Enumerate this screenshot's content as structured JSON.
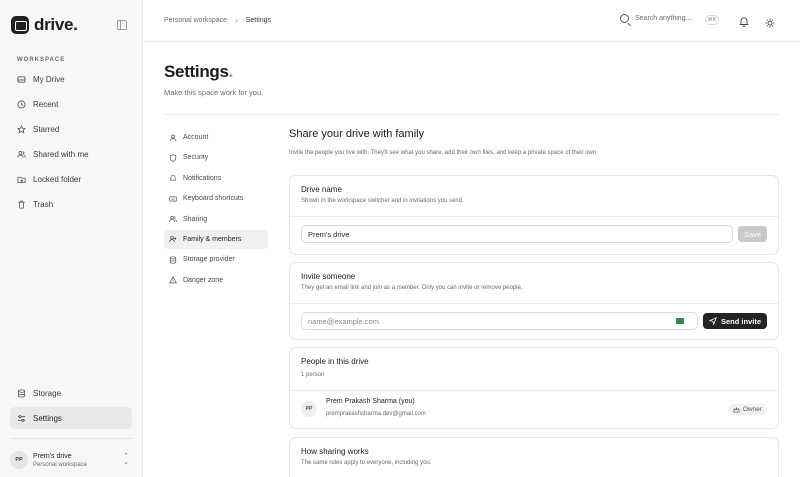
{
  "app": {
    "name": "drive."
  },
  "sidebar": {
    "section_label": "WORKSPACE",
    "items": [
      {
        "label": "My Drive",
        "icon": "drive-icon"
      },
      {
        "label": "Recent",
        "icon": "clock-icon"
      },
      {
        "label": "Starred",
        "icon": "star-icon"
      },
      {
        "label": "Shared with me",
        "icon": "users-icon"
      },
      {
        "label": "Locked folder",
        "icon": "lock-folder-icon"
      },
      {
        "label": "Trash",
        "icon": "trash-icon"
      }
    ],
    "bottom_items": [
      {
        "label": "Storage",
        "icon": "database-icon"
      },
      {
        "label": "Settings",
        "icon": "sliders-icon",
        "active": true
      }
    ],
    "account": {
      "initials": "PP",
      "name": "Prem's drive",
      "sub": "Personal workspace"
    }
  },
  "topbar": {
    "breadcrumb": [
      "Personal workspace",
      "Settings"
    ],
    "search_placeholder": "Search anything...",
    "shortcut": "⌘K"
  },
  "page": {
    "title": "Settings",
    "title_dot": ".",
    "subtitle": "Make this space work for you."
  },
  "settings_nav": [
    {
      "label": "Account",
      "icon": "user-icon"
    },
    {
      "label": "Security",
      "icon": "shield-icon"
    },
    {
      "label": "Notifications",
      "icon": "bell-icon"
    },
    {
      "label": "Keyboard shortcuts",
      "icon": "keyboard-icon"
    },
    {
      "label": "Sharing",
      "icon": "users-icon"
    },
    {
      "label": "Family & members",
      "icon": "user-plus-icon",
      "active": true
    },
    {
      "label": "Storage provider",
      "icon": "database-icon"
    },
    {
      "label": "Danger zone",
      "icon": "warning-icon"
    }
  ],
  "family": {
    "title": "Share your drive with family",
    "subtitle": "Invite the people you live with. They'll see what you share, add their own files, and keep a private space of their own.",
    "drive_name": {
      "title": "Drive name",
      "desc": "Shown in the workspace switcher and in invitations you send.",
      "value": "Prem's drive",
      "save_label": "Save"
    },
    "invite": {
      "title": "Invite someone",
      "desc": "They get an email link and join as a member. Only you can invite or remove people.",
      "placeholder": "name@example.com",
      "send_label": "Send invite"
    },
    "people": {
      "title": "People in this drive",
      "count": "1 person",
      "members": [
        {
          "initials": "PP",
          "name": "Prem Prakash Sharma (you)",
          "email": "premprakashsharma.dev@gmail.com",
          "role": "Owner"
        }
      ]
    },
    "how": {
      "title": "How sharing works",
      "desc": "The same rules apply to everyone, including you."
    }
  }
}
